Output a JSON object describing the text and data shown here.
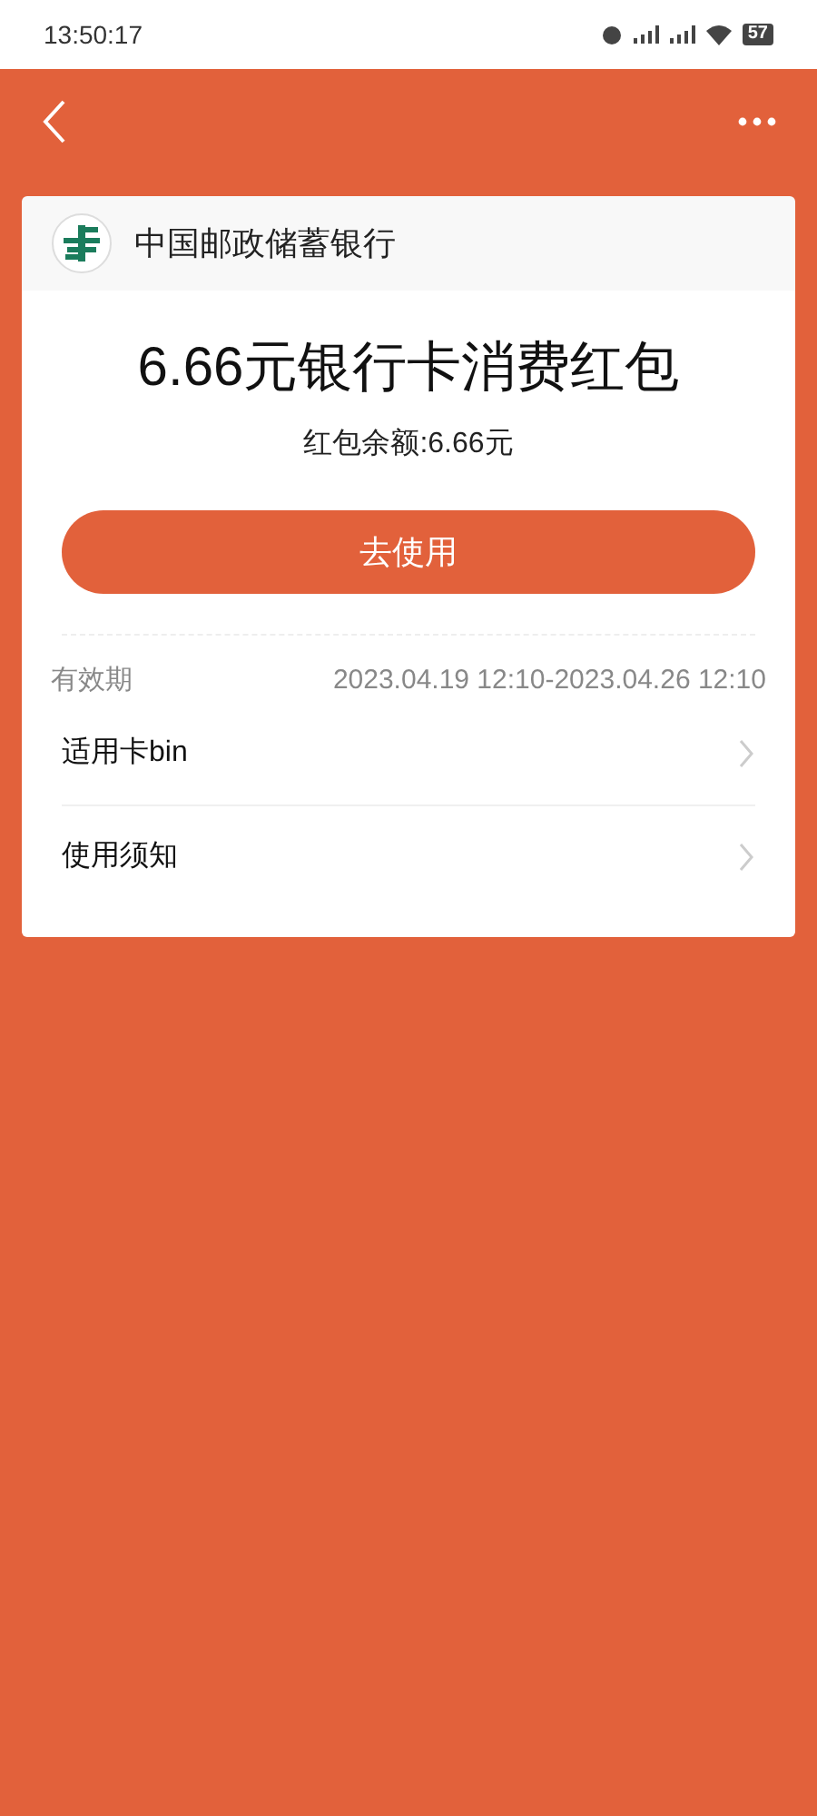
{
  "status_bar": {
    "time": "13:50:17",
    "battery": "57"
  },
  "bank": {
    "name": "中国邮政储蓄银行"
  },
  "coupon": {
    "title": "6.66元银行卡消费红包",
    "balance": "红包余额:6.66元",
    "button": "去使用"
  },
  "validity": {
    "label": "有效期",
    "value": "2023.04.19 12:10-2023.04.26 12:10"
  },
  "links": [
    {
      "label": "适用卡bin"
    },
    {
      "label": "使用须知"
    }
  ]
}
